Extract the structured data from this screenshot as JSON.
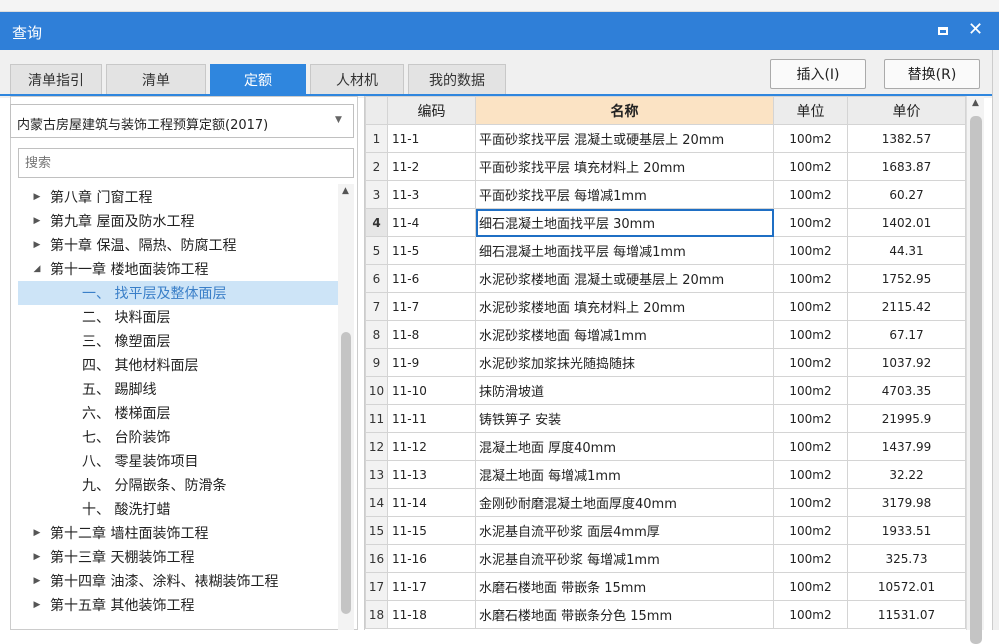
{
  "window": {
    "title": "查询",
    "maximize": "□",
    "close": "✕"
  },
  "tabs": [
    "清单指引",
    "清单",
    "定额",
    "人材机",
    "我的数据"
  ],
  "active_tab": "定额",
  "buttons": {
    "insert": "插入(I)",
    "replace": "替换(R)"
  },
  "left": {
    "combo_value": "内蒙古房屋建筑与装饰工程预算定额(2017)",
    "search_placeholder": "搜索",
    "tree": [
      {
        "label": "第八章 门窗工程",
        "level": 0,
        "state": "collapsed"
      },
      {
        "label": "第九章 屋面及防水工程",
        "level": 0,
        "state": "collapsed"
      },
      {
        "label": "第十章 保温、隔热、防腐工程",
        "level": 0,
        "state": "collapsed"
      },
      {
        "label": "第十一章 楼地面装饰工程",
        "level": 0,
        "state": "expanded"
      },
      {
        "label": "一、 找平层及整体面层",
        "level": 1,
        "selected": true
      },
      {
        "label": "二、 块料面层",
        "level": 1
      },
      {
        "label": "三、 橡塑面层",
        "level": 1
      },
      {
        "label": "四、 其他材料面层",
        "level": 1
      },
      {
        "label": "五、 踢脚线",
        "level": 1
      },
      {
        "label": "六、 楼梯面层",
        "level": 1
      },
      {
        "label": "七、 台阶装饰",
        "level": 1
      },
      {
        "label": "八、 零星装饰项目",
        "level": 1
      },
      {
        "label": "九、 分隔嵌条、防滑条",
        "level": 1
      },
      {
        "label": "十、 酸洗打蜡",
        "level": 1
      },
      {
        "label": "第十二章 墙柱面装饰工程",
        "level": 0,
        "state": "collapsed"
      },
      {
        "label": "第十三章 天棚装饰工程",
        "level": 0,
        "state": "collapsed"
      },
      {
        "label": "第十四章 油漆、涂料、裱糊装饰工程",
        "level": 0,
        "state": "collapsed"
      },
      {
        "label": "第十五章 其他装饰工程",
        "level": 0,
        "state": "collapsed"
      }
    ]
  },
  "grid": {
    "headers": [
      "",
      "编码",
      "名称",
      "单位",
      "单价"
    ],
    "current_row": 4,
    "rows": [
      [
        "1",
        "11-1",
        "平面砂浆找平层 混凝土或硬基层上 20mm",
        "100m2",
        "1382.57"
      ],
      [
        "2",
        "11-2",
        "平面砂浆找平层 填充材料上 20mm",
        "100m2",
        "1683.87"
      ],
      [
        "3",
        "11-3",
        "平面砂浆找平层 每增减1mm",
        "100m2",
        "60.27"
      ],
      [
        "4",
        "11-4",
        "细石混凝土地面找平层 30mm",
        "100m2",
        "1402.01"
      ],
      [
        "5",
        "11-5",
        "细石混凝土地面找平层 每增减1mm",
        "100m2",
        "44.31"
      ],
      [
        "6",
        "11-6",
        "水泥砂浆楼地面 混凝土或硬基层上 20mm",
        "100m2",
        "1752.95"
      ],
      [
        "7",
        "11-7",
        "水泥砂浆楼地面 填充材料上 20mm",
        "100m2",
        "2115.42"
      ],
      [
        "8",
        "11-8",
        "水泥砂浆楼地面 每增减1mm",
        "100m2",
        "67.17"
      ],
      [
        "9",
        "11-9",
        "水泥砂浆加浆抹光随捣随抹",
        "100m2",
        "1037.92"
      ],
      [
        "10",
        "11-10",
        "抹防滑坡道",
        "100m2",
        "4703.35"
      ],
      [
        "11",
        "11-11",
        "铸铁箅子 安装",
        "100m2",
        "21995.9"
      ],
      [
        "12",
        "11-12",
        "混凝土地面 厚度40mm",
        "100m2",
        "1437.99"
      ],
      [
        "13",
        "11-13",
        "混凝土地面 每增减1mm",
        "100m2",
        "32.22"
      ],
      [
        "14",
        "11-14",
        "金刚砂耐磨混凝土地面厚度40mm",
        "100m2",
        "3179.98"
      ],
      [
        "15",
        "11-15",
        "水泥基自流平砂浆 面层4mm厚",
        "100m2",
        "1933.51"
      ],
      [
        "16",
        "11-16",
        "水泥基自流平砂浆 每增减1mm",
        "100m2",
        "325.73"
      ],
      [
        "17",
        "11-17",
        "水磨石楼地面 带嵌条 15mm",
        "100m2",
        "10572.01"
      ],
      [
        "18",
        "11-18",
        "水磨石楼地面 带嵌条分色 15mm",
        "100m2",
        "11531.07"
      ]
    ]
  }
}
